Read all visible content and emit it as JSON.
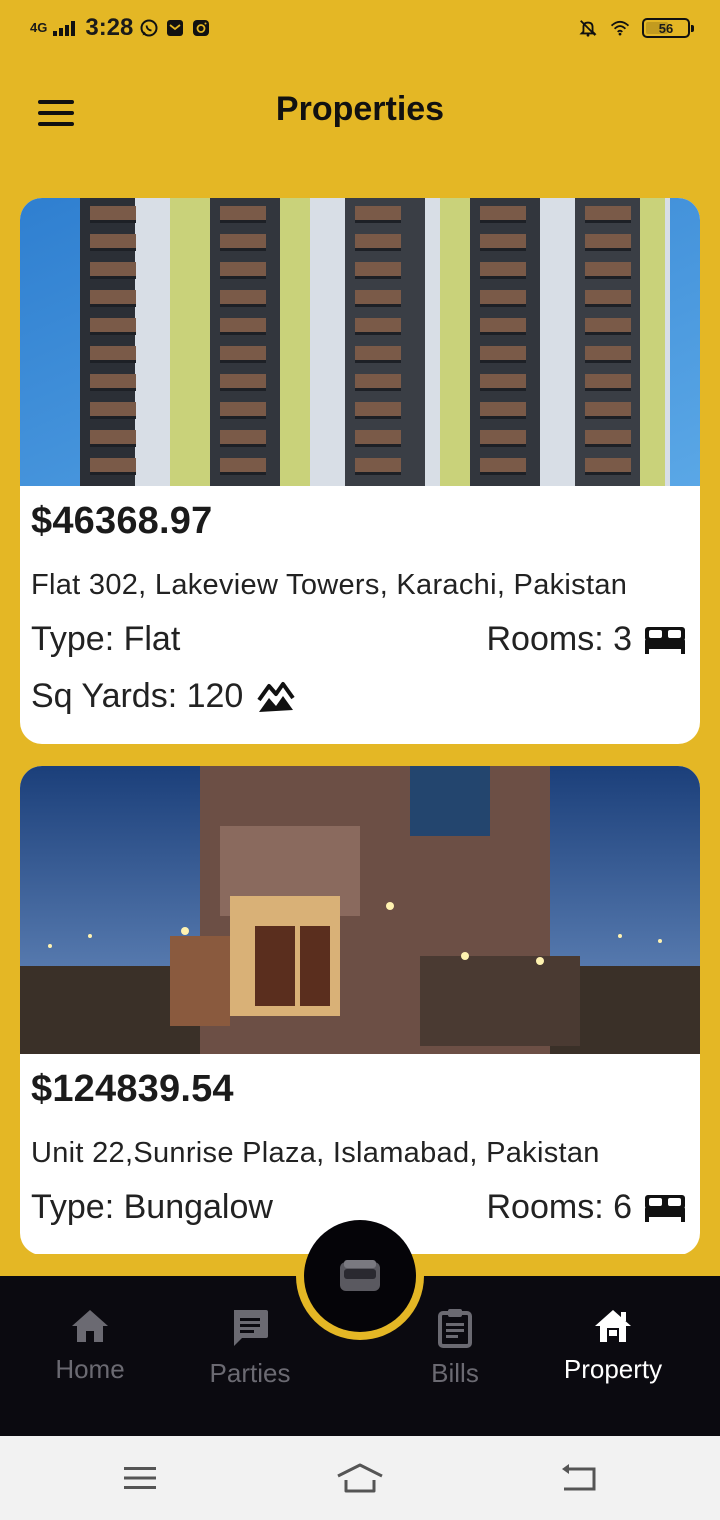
{
  "status_bar": {
    "network": "4G",
    "time": "3:28",
    "battery": "56",
    "battery_level": 0.56,
    "icons": [
      "whatsapp-icon",
      "mail-icon",
      "instagram-icon",
      "mute-bell-icon",
      "wifi-icon"
    ]
  },
  "app_bar": {
    "title": "Properties",
    "menu_icon": "hamburger-icon"
  },
  "properties": [
    {
      "price": "$46368.97",
      "address": "Flat 302, Lakeview Towers, Karachi, Pakistan",
      "type": "Type: Flat",
      "rooms": "Rooms: 3",
      "sq_yards": "Sq Yards: 120",
      "image": "apartment-tower-photo"
    },
    {
      "price": "$124839.54",
      "address": "Unit 22,Sunrise Plaza, Islamabad, Pakistan",
      "type": "Type: Bungalow",
      "rooms": "Rooms: 6",
      "image": "bungalow-night-photo"
    }
  ],
  "bottom_nav": {
    "items": [
      {
        "label": "Home",
        "icon": "home-icon",
        "active": false
      },
      {
        "label": "Parties",
        "icon": "chat-icon",
        "active": false
      },
      {
        "label": "Bills",
        "icon": "clipboard-icon",
        "active": false
      },
      {
        "label": "Property",
        "icon": "property-house-icon",
        "active": true
      }
    ],
    "fab_icon": "wallet-icon"
  },
  "colors": {
    "accent": "#e4b725",
    "nav_background": "#0b0a10",
    "card_background": "#ffffff",
    "inactive": "#6b6a72",
    "active": "#ffffff"
  },
  "system_nav": {
    "icons": [
      "menu-lines-icon",
      "home-outline-icon",
      "back-icon"
    ]
  }
}
